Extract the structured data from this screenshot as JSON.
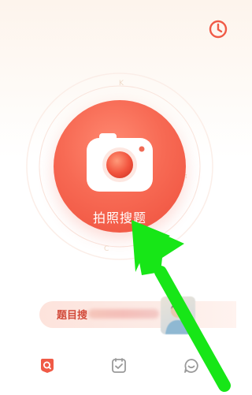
{
  "main": {
    "camera_button_label": "拍照搜题"
  },
  "topic_search": {
    "label": "题目搜"
  },
  "icons": {
    "history": "clock-icon",
    "camera": "camera-icon",
    "tab_home": "search-home-icon",
    "tab_check": "check-square-icon",
    "tab_chat": "chat-bubble-icon"
  },
  "colors": {
    "accent": "#f05a46",
    "icon_inactive": "#9a9a9a",
    "annotation_arrow": "#17e617"
  }
}
